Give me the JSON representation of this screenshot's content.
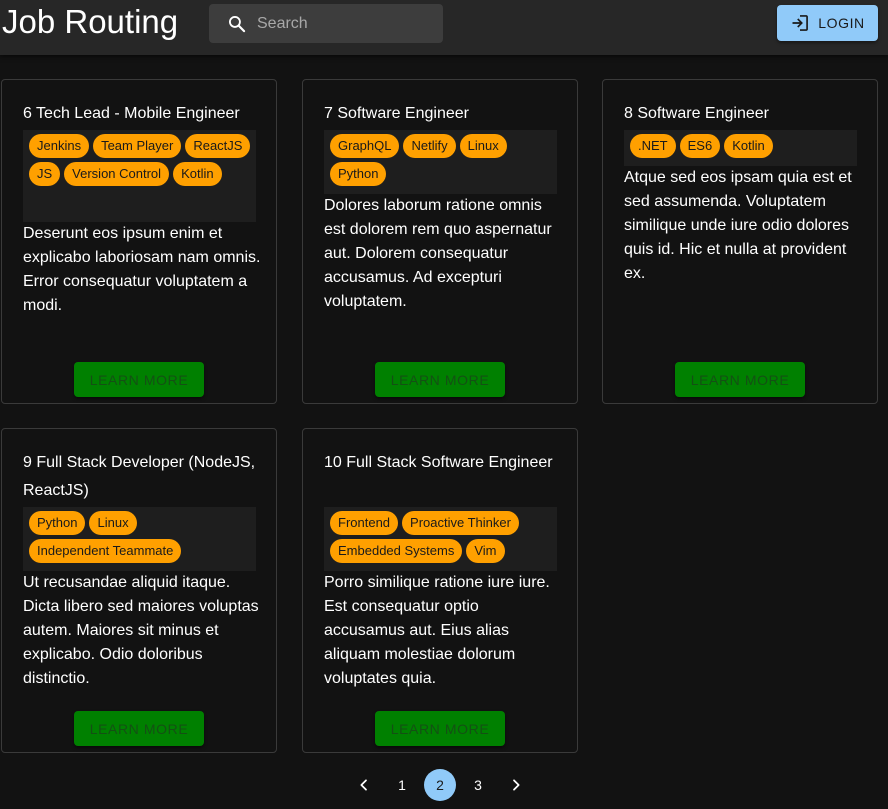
{
  "app": {
    "title": "Job Routing",
    "search_placeholder": "Search",
    "search_icon": "magnifier",
    "login_label": "LOGIN",
    "login_icon": "login-arrow",
    "colors": {
      "appbar": "#272727",
      "background": "#121212",
      "primary": "#90caf9",
      "tag": "#ffa000",
      "button": "#008000"
    }
  },
  "jobs": [
    {
      "title": "6 Tech Lead - Mobile Engineer",
      "tags": [
        "Jenkins",
        "Team Player",
        "ReactJS",
        "JS",
        "Version Control",
        "Kotlin"
      ],
      "description": "Deserunt eos ipsum enim et explicabo laboriosam nam omnis. Error consequatur voluptatem a modi.",
      "button": "LEARN MORE"
    },
    {
      "title": "7 Software Engineer",
      "tags": [
        "GraphQL",
        "Netlify",
        "Linux",
        "Python"
      ],
      "description": "Dolores laborum ratione omnis est dolorem rem quo aspernatur aut. Dolorem consequatur accusamus. Ad excepturi voluptatem.",
      "button": "LEARN MORE"
    },
    {
      "title": "8 Software Engineer",
      "tags": [
        ".NET",
        "ES6",
        "Kotlin"
      ],
      "description": "Atque sed eos ipsam quia est et sed assumenda. Voluptatem similique unde iure odio dolores quis id. Hic et nulla at provident ex.",
      "button": "LEARN MORE"
    },
    {
      "title": "9 Full Stack Developer (NodeJS, ReactJS)",
      "tags": [
        "Python",
        "Linux",
        "Independent Teammate"
      ],
      "description": "Ut recusandae aliquid itaque. Dicta libero sed maiores voluptas autem. Maiores sit minus et explicabo. Odio doloribus distinctio.",
      "button": "LEARN MORE"
    },
    {
      "title": "10 Full Stack Software Engineer",
      "tags": [
        "Frontend",
        "Proactive Thinker",
        "Embedded Systems",
        "Vim"
      ],
      "description": "Porro similique ratione iure iure. Est consequatur optio accusamus aut. Eius alias aliquam molestiae dolorum voluptates quia.",
      "button": "LEARN MORE"
    }
  ],
  "pagination": {
    "prev_icon": "chevron-left",
    "next_icon": "chevron-right",
    "pages": [
      "1",
      "2",
      "3"
    ],
    "current": "2"
  }
}
